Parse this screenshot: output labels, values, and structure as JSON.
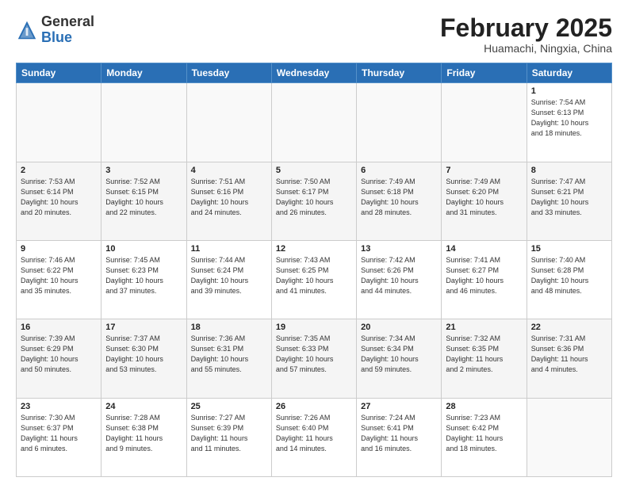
{
  "header": {
    "logo": {
      "general": "General",
      "blue": "Blue"
    },
    "title": "February 2025",
    "location": "Huamachi, Ningxia, China"
  },
  "calendar": {
    "days_of_week": [
      "Sunday",
      "Monday",
      "Tuesday",
      "Wednesday",
      "Thursday",
      "Friday",
      "Saturday"
    ],
    "weeks": [
      [
        {
          "day": "",
          "info": ""
        },
        {
          "day": "",
          "info": ""
        },
        {
          "day": "",
          "info": ""
        },
        {
          "day": "",
          "info": ""
        },
        {
          "day": "",
          "info": ""
        },
        {
          "day": "",
          "info": ""
        },
        {
          "day": "1",
          "info": "Sunrise: 7:54 AM\nSunset: 6:13 PM\nDaylight: 10 hours\nand 18 minutes."
        }
      ],
      [
        {
          "day": "2",
          "info": "Sunrise: 7:53 AM\nSunset: 6:14 PM\nDaylight: 10 hours\nand 20 minutes."
        },
        {
          "day": "3",
          "info": "Sunrise: 7:52 AM\nSunset: 6:15 PM\nDaylight: 10 hours\nand 22 minutes."
        },
        {
          "day": "4",
          "info": "Sunrise: 7:51 AM\nSunset: 6:16 PM\nDaylight: 10 hours\nand 24 minutes."
        },
        {
          "day": "5",
          "info": "Sunrise: 7:50 AM\nSunset: 6:17 PM\nDaylight: 10 hours\nand 26 minutes."
        },
        {
          "day": "6",
          "info": "Sunrise: 7:49 AM\nSunset: 6:18 PM\nDaylight: 10 hours\nand 28 minutes."
        },
        {
          "day": "7",
          "info": "Sunrise: 7:49 AM\nSunset: 6:20 PM\nDaylight: 10 hours\nand 31 minutes."
        },
        {
          "day": "8",
          "info": "Sunrise: 7:47 AM\nSunset: 6:21 PM\nDaylight: 10 hours\nand 33 minutes."
        }
      ],
      [
        {
          "day": "9",
          "info": "Sunrise: 7:46 AM\nSunset: 6:22 PM\nDaylight: 10 hours\nand 35 minutes."
        },
        {
          "day": "10",
          "info": "Sunrise: 7:45 AM\nSunset: 6:23 PM\nDaylight: 10 hours\nand 37 minutes."
        },
        {
          "day": "11",
          "info": "Sunrise: 7:44 AM\nSunset: 6:24 PM\nDaylight: 10 hours\nand 39 minutes."
        },
        {
          "day": "12",
          "info": "Sunrise: 7:43 AM\nSunset: 6:25 PM\nDaylight: 10 hours\nand 41 minutes."
        },
        {
          "day": "13",
          "info": "Sunrise: 7:42 AM\nSunset: 6:26 PM\nDaylight: 10 hours\nand 44 minutes."
        },
        {
          "day": "14",
          "info": "Sunrise: 7:41 AM\nSunset: 6:27 PM\nDaylight: 10 hours\nand 46 minutes."
        },
        {
          "day": "15",
          "info": "Sunrise: 7:40 AM\nSunset: 6:28 PM\nDaylight: 10 hours\nand 48 minutes."
        }
      ],
      [
        {
          "day": "16",
          "info": "Sunrise: 7:39 AM\nSunset: 6:29 PM\nDaylight: 10 hours\nand 50 minutes."
        },
        {
          "day": "17",
          "info": "Sunrise: 7:37 AM\nSunset: 6:30 PM\nDaylight: 10 hours\nand 53 minutes."
        },
        {
          "day": "18",
          "info": "Sunrise: 7:36 AM\nSunset: 6:31 PM\nDaylight: 10 hours\nand 55 minutes."
        },
        {
          "day": "19",
          "info": "Sunrise: 7:35 AM\nSunset: 6:33 PM\nDaylight: 10 hours\nand 57 minutes."
        },
        {
          "day": "20",
          "info": "Sunrise: 7:34 AM\nSunset: 6:34 PM\nDaylight: 10 hours\nand 59 minutes."
        },
        {
          "day": "21",
          "info": "Sunrise: 7:32 AM\nSunset: 6:35 PM\nDaylight: 11 hours\nand 2 minutes."
        },
        {
          "day": "22",
          "info": "Sunrise: 7:31 AM\nSunset: 6:36 PM\nDaylight: 11 hours\nand 4 minutes."
        }
      ],
      [
        {
          "day": "23",
          "info": "Sunrise: 7:30 AM\nSunset: 6:37 PM\nDaylight: 11 hours\nand 6 minutes."
        },
        {
          "day": "24",
          "info": "Sunrise: 7:28 AM\nSunset: 6:38 PM\nDaylight: 11 hours\nand 9 minutes."
        },
        {
          "day": "25",
          "info": "Sunrise: 7:27 AM\nSunset: 6:39 PM\nDaylight: 11 hours\nand 11 minutes."
        },
        {
          "day": "26",
          "info": "Sunrise: 7:26 AM\nSunset: 6:40 PM\nDaylight: 11 hours\nand 14 minutes."
        },
        {
          "day": "27",
          "info": "Sunrise: 7:24 AM\nSunset: 6:41 PM\nDaylight: 11 hours\nand 16 minutes."
        },
        {
          "day": "28",
          "info": "Sunrise: 7:23 AM\nSunset: 6:42 PM\nDaylight: 11 hours\nand 18 minutes."
        },
        {
          "day": "",
          "info": ""
        }
      ]
    ]
  }
}
